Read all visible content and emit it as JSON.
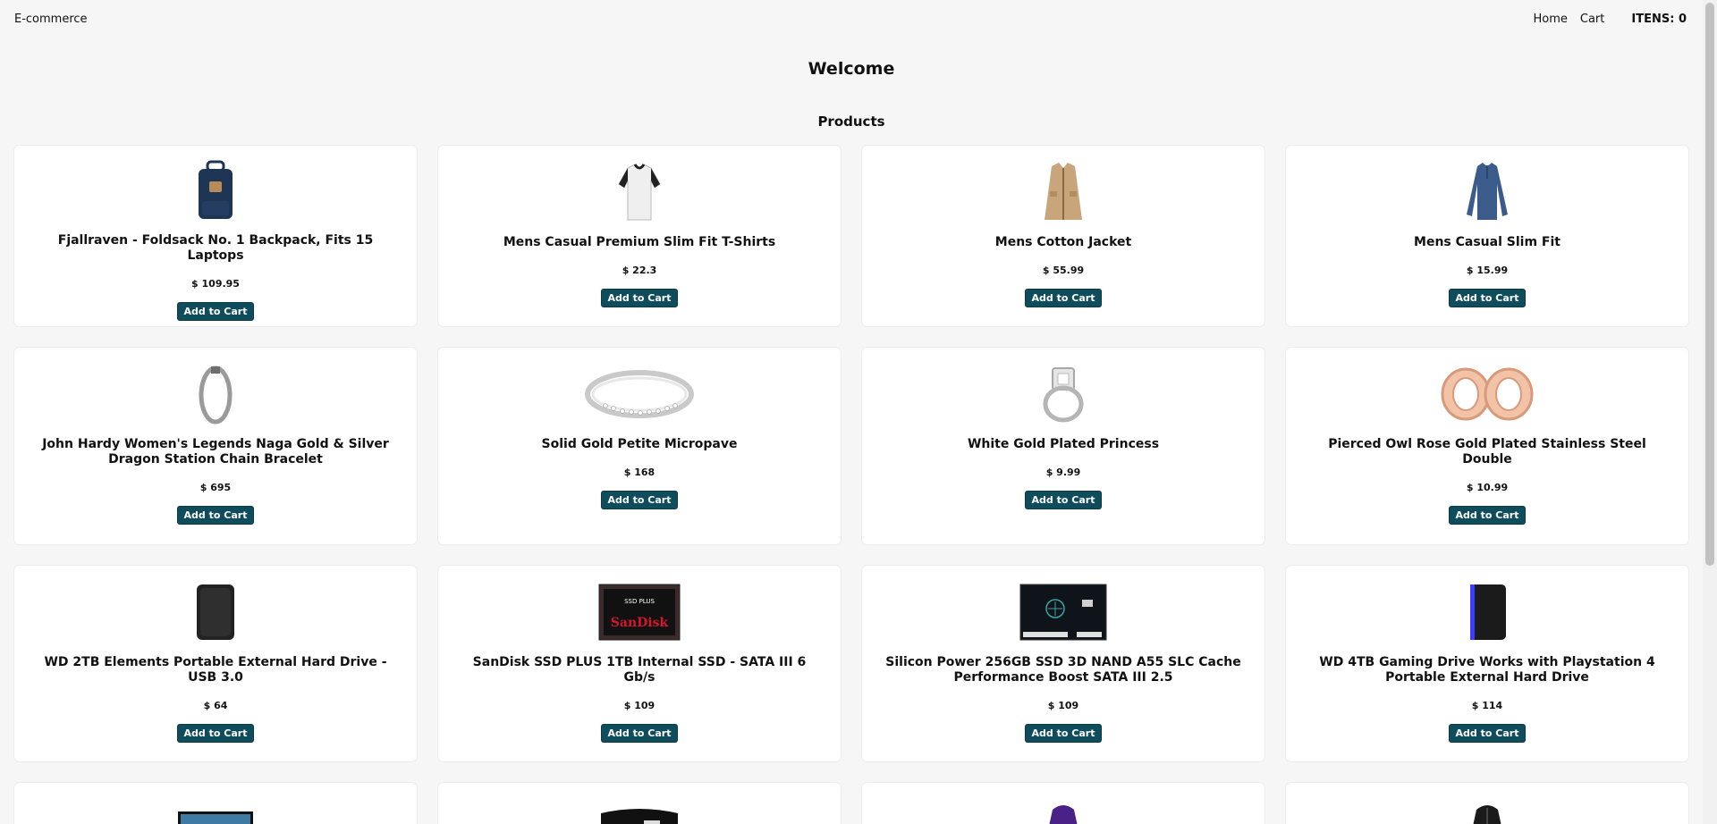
{
  "header": {
    "brand": "E-commerce",
    "nav": {
      "home": "Home",
      "cart": "Cart",
      "items": "ITENS: 0"
    }
  },
  "main": {
    "welcome": "Welcome",
    "products_title": "Products"
  },
  "products": [
    {
      "title": "Fjallraven - Foldsack No. 1 Backpack, Fits 15 Laptops",
      "price": "$ 109.95",
      "button": "Add to Cart",
      "icon": "backpack-icon"
    },
    {
      "title": "Mens Casual Premium Slim Fit T-Shirts",
      "price": "$ 22.3",
      "button": "Add to Cart",
      "icon": "tshirt-icon"
    },
    {
      "title": "Mens Cotton Jacket",
      "price": "$ 55.99",
      "button": "Add to Cart",
      "icon": "jacket-icon"
    },
    {
      "title": "Mens Casual Slim Fit",
      "price": "$ 15.99",
      "button": "Add to Cart",
      "icon": "longsleeve-icon"
    },
    {
      "title": "John Hardy Women's Legends Naga Gold & Silver Dragon Station Chain Bracelet",
      "price": "$ 695",
      "button": "Add to Cart",
      "icon": "bracelet-icon"
    },
    {
      "title": "Solid Gold Petite Micropave",
      "price": "$ 168",
      "button": "Add to Cart",
      "icon": "ring-icon"
    },
    {
      "title": "White Gold Plated Princess",
      "price": "$ 9.99",
      "button": "Add to Cart",
      "icon": "diamond-ring-icon"
    },
    {
      "title": "Pierced Owl Rose Gold Plated Stainless Steel Double",
      "price": "$ 10.99",
      "button": "Add to Cart",
      "icon": "rosegold-plugs-icon"
    },
    {
      "title": "WD 2TB Elements Portable External Hard Drive - USB 3.0",
      "price": "$ 64",
      "button": "Add to Cart",
      "icon": "hdd-icon"
    },
    {
      "title": "SanDisk SSD PLUS 1TB Internal SSD - SATA III 6 Gb/s",
      "price": "$ 109",
      "button": "Add to Cart",
      "icon": "ssd-icon",
      "brand_text": "SanDisk",
      "product_text": "SSD PLUS"
    },
    {
      "title": "Silicon Power 256GB SSD 3D NAND A55 SLC Cache Performance Boost SATA III 2.5",
      "price": "$ 109",
      "button": "Add to Cart",
      "icon": "ssd-sp-icon"
    },
    {
      "title": "WD 4TB Gaming Drive Works with Playstation 4 Portable External Hard Drive",
      "price": "$ 114",
      "button": "Add to Cart",
      "icon": "gaming-drive-icon"
    },
    {
      "title": "",
      "price": "",
      "button": "",
      "icon": "monitor-icon"
    },
    {
      "title": "",
      "price": "",
      "button": "",
      "icon": "curved-monitor-icon"
    },
    {
      "title": "",
      "price": "",
      "button": "",
      "icon": "purple-jacket-icon"
    },
    {
      "title": "",
      "price": "",
      "button": "",
      "icon": "black-jacket-icon"
    }
  ],
  "colors": {
    "button_bg": "#0f4c5c",
    "page_bg": "#f6f6f6"
  }
}
